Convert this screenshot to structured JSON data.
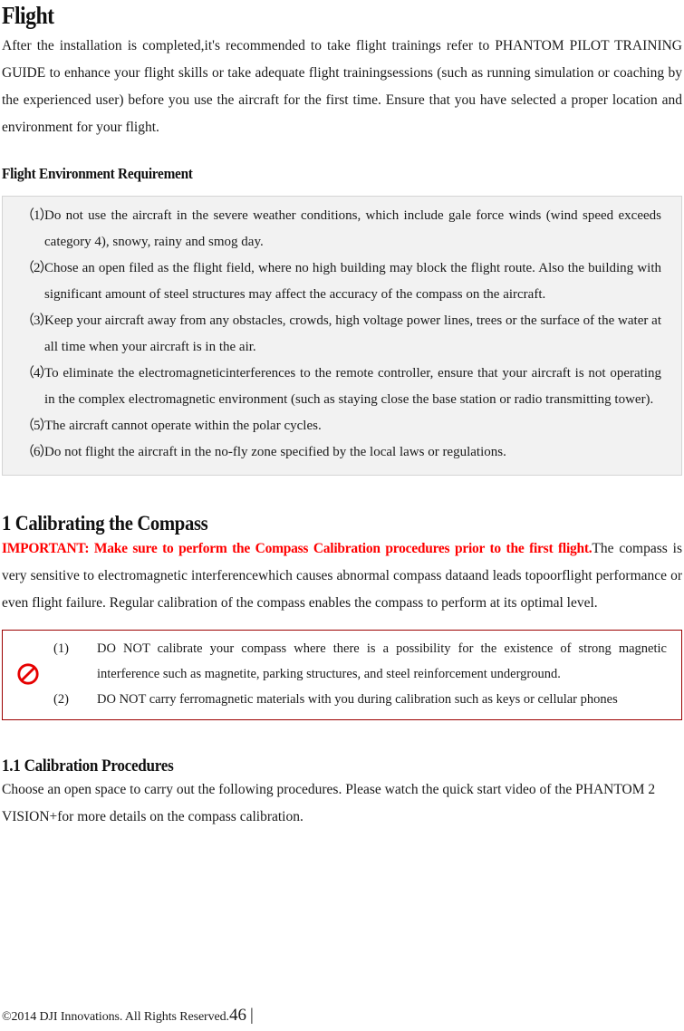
{
  "document": {
    "title": "Flight",
    "intro_paragraph": "After the installation is completed,it's recommended to take flight trainings refer to PHANTOM PILOT TRAINING GUIDE to enhance your flight skills or take adequate flight trainingsessions (such as running simulation or coaching by the experienced user) before you use the aircraft for the first time. Ensure that you have selected a proper location and environment for your flight."
  },
  "flight_environment": {
    "heading": "Flight Environment Requirement",
    "items": [
      {
        "marker": "（1）",
        "text": "Do not use the aircraft in the severe weather conditions, which include gale force winds (wind speed exceeds category 4), snowy, rainy and smog day."
      },
      {
        "marker": "（2）",
        "text": "Chose an open filed as the flight field, where no high building may block the flight route. Also the building with significant amount of steel structures may affect the accuracy of the compass on the aircraft."
      },
      {
        "marker": "（3）",
        "text": "Keep your aircraft away from any obstacles, crowds, high voltage power lines, trees or the surface of the water at all time when your aircraft is in the air."
      },
      {
        "marker": "（4）",
        "text": "To eliminate the electromagneticinterferences to the remote controller, ensure that your aircraft is not operating in the complex electromagnetic environment (such as staying close the base station or radio transmitting tower)."
      },
      {
        "marker": "（5）",
        "text": "The aircraft cannot operate within the polar cycles."
      },
      {
        "marker": "（6）",
        "text": "Do not flight the aircraft in the no-fly zone specified by the local laws or regulations."
      }
    ]
  },
  "calibrating_compass": {
    "heading": "1 Calibrating the Compass",
    "important_red": "IMPORTANT: Make sure to perform the Compass Calibration procedures prior to the first flight.",
    "body": "The compass is very sensitive to electromagnetic interferencewhich causes abnormal compass dataand leads topoorflight performance or even flight failure. Regular calibration of the compass enables the compass to perform at its optimal level."
  },
  "warning_box": {
    "icon": "prohibition-icon",
    "border_color": "#9c0000",
    "items": [
      {
        "marker": "(1)",
        "text": "DO NOT calibrate your compass where there is a possibility for the existence of strong magnetic interference such as magnetite, parking structures, and steel reinforcement underground."
      },
      {
        "marker": "(2)",
        "text": "DO NOT carry ferromagnetic materials with you during calibration such as keys or cellular phones"
      }
    ]
  },
  "calibration_procedures": {
    "heading": "1.1 Calibration Procedures",
    "body": "Choose an open space to carry out the following procedures. Please watch the quick start video of the PHANTOM 2 VISION+for more details on the compass calibration."
  },
  "footer": {
    "copyright": "©2014 DJI Innovations. All Rights Reserved.",
    "page_number": "46",
    "separator": "|"
  }
}
